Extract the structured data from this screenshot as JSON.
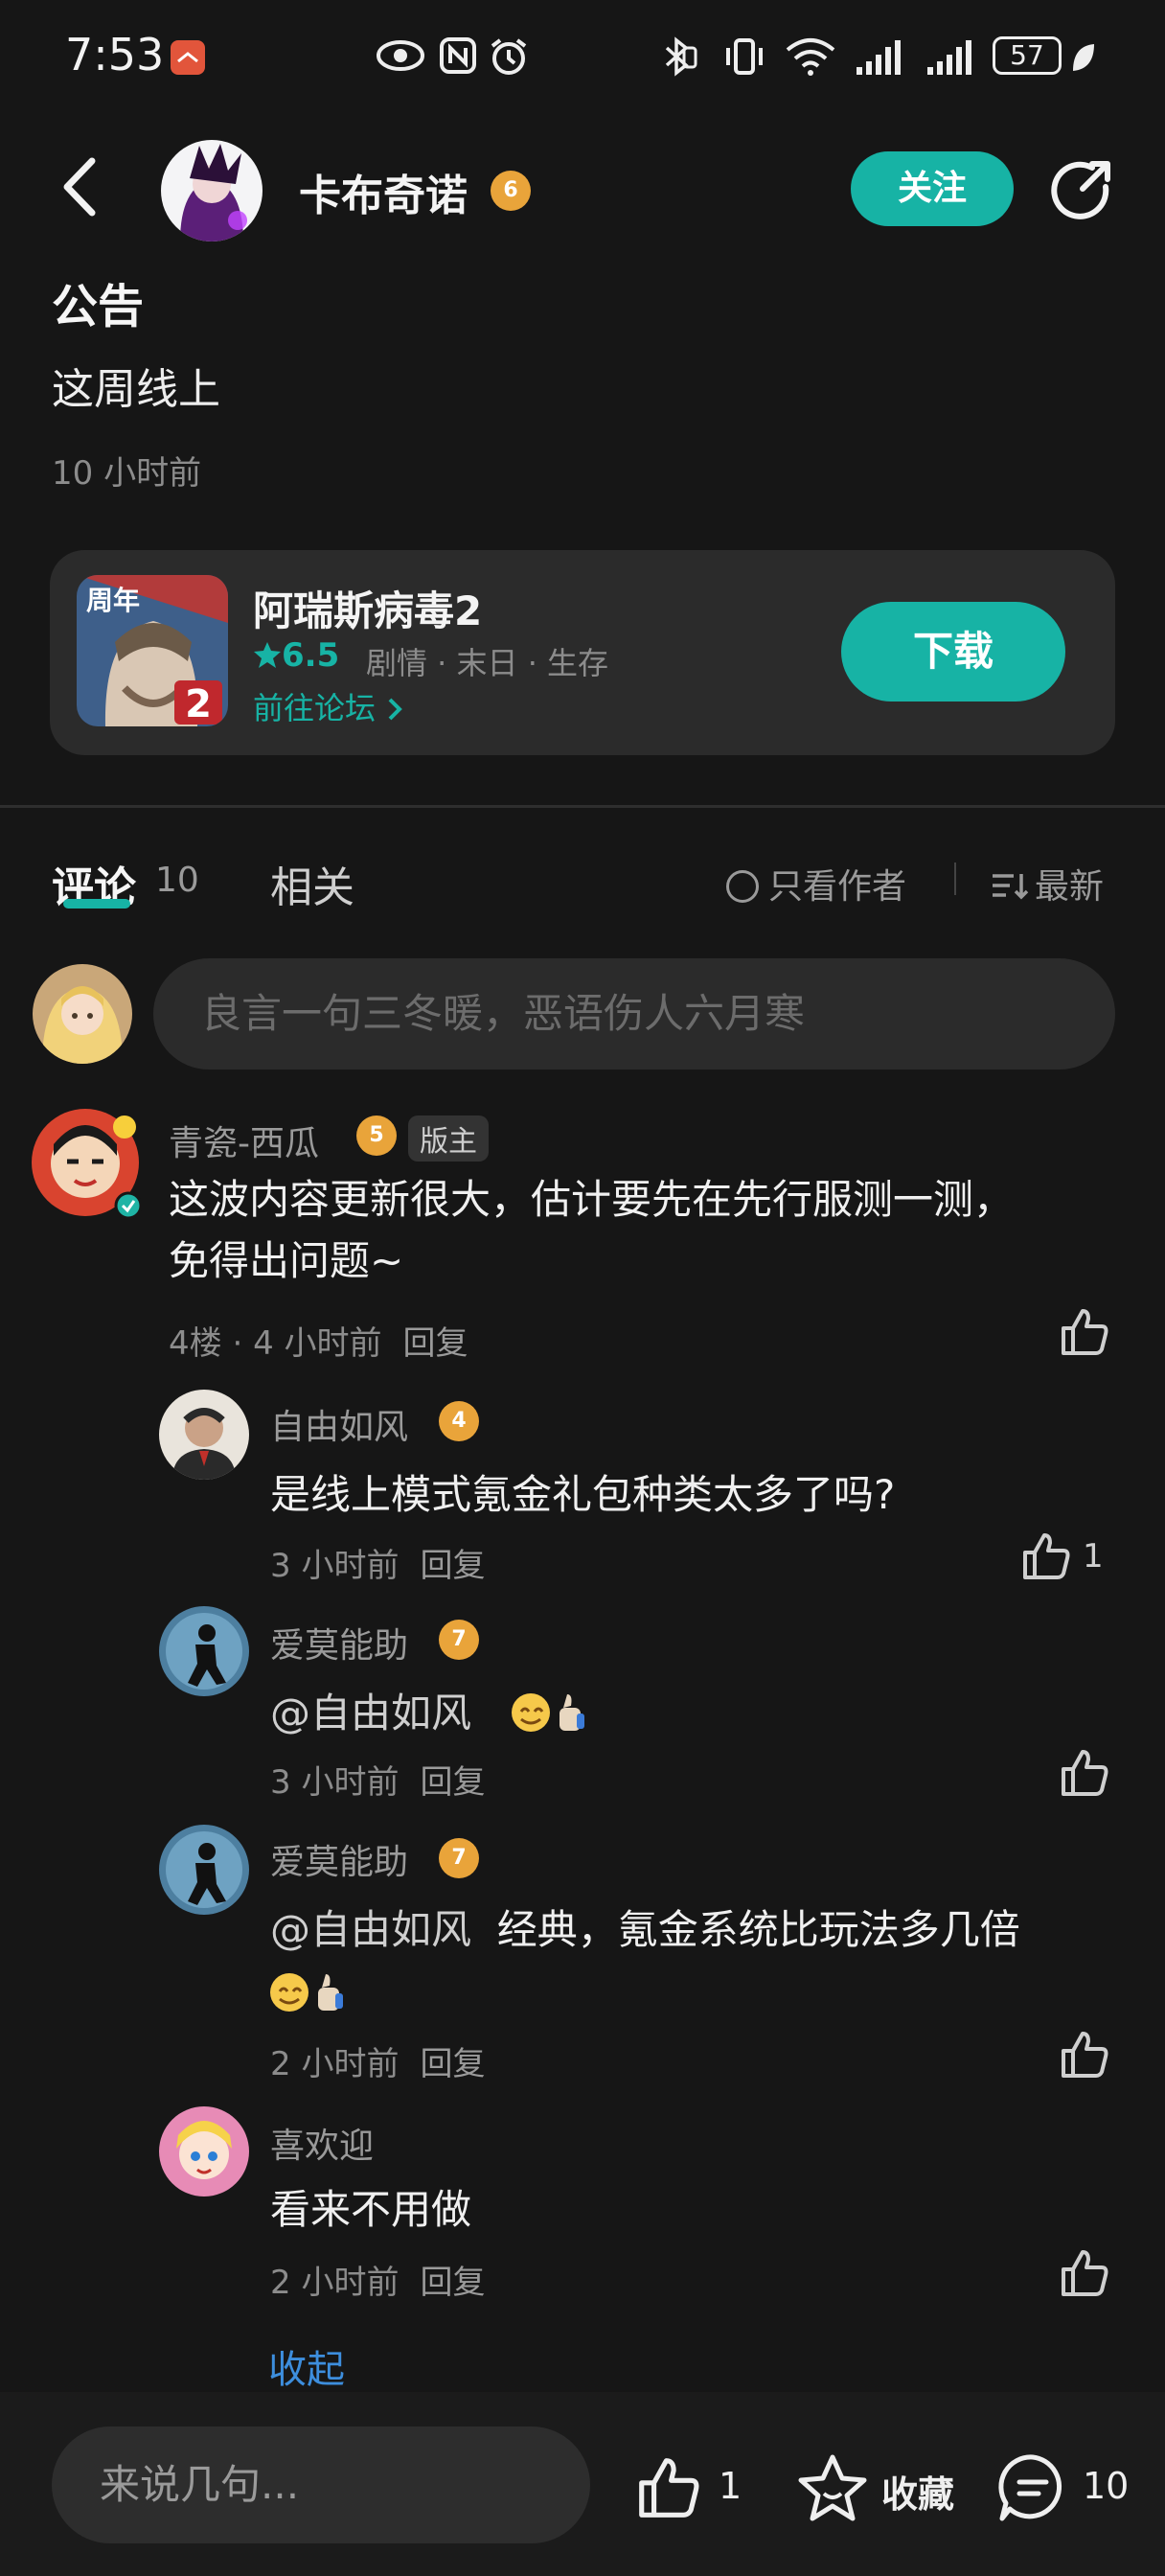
{
  "status_bar": {
    "time": "7:53",
    "battery": "57"
  },
  "header": {
    "author_name": "卡布奇诺",
    "author_level": "6",
    "follow_label": "关注"
  },
  "notice": {
    "title": "公告",
    "body": "这周线上",
    "time": "10 小时前"
  },
  "game_card": {
    "name": "阿瑞斯病毒2",
    "score": "6.5",
    "tags": "剧情 · 末日 · 生存",
    "forum_link": "前往论坛",
    "download_label": "下载",
    "icon_badge": "周年",
    "icon_number": "2"
  },
  "tabs": {
    "comment_label": "评论",
    "comment_count": "10",
    "related_label": "相关",
    "only_author": "只看作者",
    "sort": "最新"
  },
  "comment_input": {
    "placeholder": "良言一句三冬暖，恶语伤人六月寒"
  },
  "comments": [
    {
      "user": "青瓷-西瓜",
      "level": "5",
      "badge": "版主",
      "text1": "这波内容更新很大，估计要先在先行服测一测，",
      "text2": "免得出问题~",
      "floor": "4楼",
      "time": "4 小时前",
      "reply": "回复"
    }
  ],
  "replies": [
    {
      "user": "自由如风",
      "level": "4",
      "text": "是线上模式氪金礼包种类太多了吗?",
      "time": "3 小时前",
      "reply": "回复",
      "likes": "1"
    },
    {
      "user": "爱莫能助",
      "level": "7",
      "mention": "@自由如风",
      "text": "",
      "time": "3 小时前",
      "reply": "回复"
    },
    {
      "user": "爱莫能助",
      "level": "7",
      "mention": "@自由如风",
      "text": "经典，氪金系统比玩法多几倍",
      "time": "2 小时前",
      "reply": "回复"
    },
    {
      "user": "喜欢迎",
      "text": "看来不用做",
      "time": "2 小时前",
      "reply": "回复"
    }
  ],
  "collapse_label": "收起",
  "bottom_bar": {
    "input_placeholder": "来说几句...",
    "like_count": "1",
    "favorite_label": "收藏",
    "comment_count": "10"
  },
  "colors": {
    "accent": "#17b3a5",
    "background": "#161616",
    "link": "#3d8edd"
  }
}
